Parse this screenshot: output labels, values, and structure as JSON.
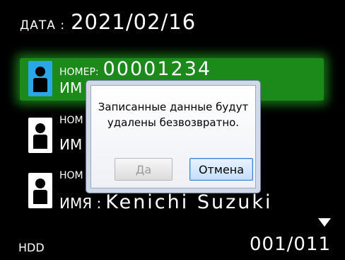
{
  "header": {
    "date_label": "ДАТА :",
    "date_value": "2021/02/16"
  },
  "entries": [
    {
      "number_label": "НОМЕР:",
      "number_value": "00001234",
      "name_label": "ИМ",
      "name_value": "",
      "selected": true
    },
    {
      "number_label": "НОМ",
      "number_value": "",
      "name_label": "ИМ",
      "name_value": "",
      "selected": false
    },
    {
      "number_label": "НОМ",
      "number_value": "",
      "name_label": "ИМЯ :",
      "name_value": "Kenichi Suzuki",
      "selected": false
    }
  ],
  "footer": {
    "media": "HDD",
    "counter": "001/011"
  },
  "dialog": {
    "message": "Записанные данные будут удалены безвозвратно.",
    "yes_label": "Да",
    "cancel_label": "Отмена"
  },
  "colors": {
    "selected_row": "#1b8a1b",
    "selected_avatar": "#2aa7e8",
    "cancel_border": "#3c7fd6"
  }
}
